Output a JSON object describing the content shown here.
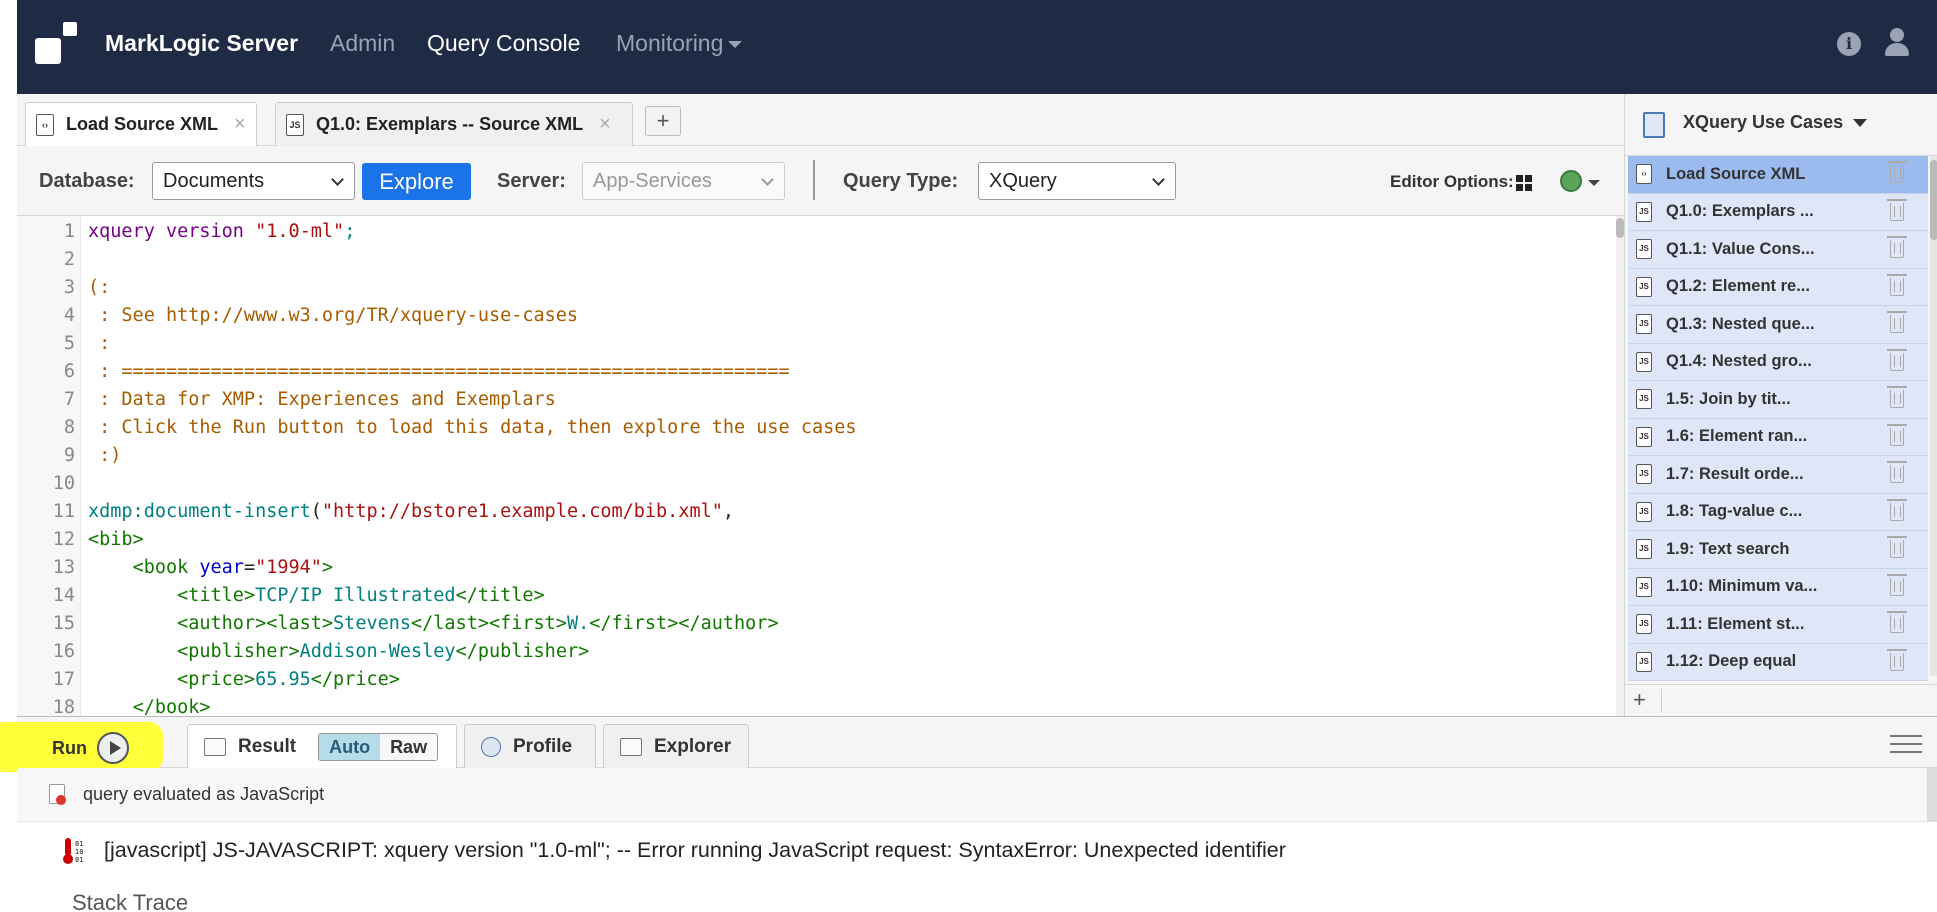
{
  "navbar": {
    "brand": "MarkLogic Server",
    "links": [
      "Admin",
      "Query Console",
      "Monitoring"
    ],
    "active_link": "Query Console",
    "info_glyph": "i",
    "icons": [
      "info-icon",
      "user-icon"
    ]
  },
  "tabs": [
    {
      "label": "Load Source XML",
      "type": "XQ",
      "active": true
    },
    {
      "label": "Q1.0: Exemplars -- Source XML",
      "type": "JS",
      "active": false
    }
  ],
  "tab_close": "×",
  "add_tab": "+",
  "options": {
    "database_label": "Database:",
    "database_value": "Documents",
    "explore_label": "Explore",
    "server_label": "Server:",
    "server_value": "App-Services",
    "query_type_label": "Query Type:",
    "query_type_value": "XQuery",
    "editor_options_label": "Editor Options:"
  },
  "editor": {
    "line_numbers": [
      "1",
      "2",
      "3",
      "4",
      "5",
      "6",
      "7",
      "8",
      "9",
      "10",
      "11",
      "12",
      "13",
      "14",
      "15",
      "16",
      "17",
      "18"
    ]
  },
  "workspace": {
    "title": "XQuery Use Cases",
    "add": "+",
    "queries": [
      {
        "label": "Load Source XML",
        "type": "XQ",
        "selected": true
      },
      {
        "label": "Q1.0: Exemplars ...",
        "type": "JS",
        "selected": false
      },
      {
        "label": "Q1.1: Value Cons...",
        "type": "JS",
        "selected": false
      },
      {
        "label": "Q1.2: Element re...",
        "type": "JS",
        "selected": false
      },
      {
        "label": "Q1.3: Nested que...",
        "type": "JS",
        "selected": false
      },
      {
        "label": "Q1.4: Nested gro...",
        "type": "JS",
        "selected": false
      },
      {
        "label": "1.5: Join by tit...",
        "type": "JS",
        "selected": false
      },
      {
        "label": "1.6: Element ran...",
        "type": "JS",
        "selected": false
      },
      {
        "label": "1.7: Result orde...",
        "type": "JS",
        "selected": false
      },
      {
        "label": "1.8: Tag-value c...",
        "type": "JS",
        "selected": false
      },
      {
        "label": "1.9: Text search",
        "type": "JS",
        "selected": false
      },
      {
        "label": "1.10: Minimum va...",
        "type": "JS",
        "selected": false
      },
      {
        "label": "1.11: Element st...",
        "type": "JS",
        "selected": false
      },
      {
        "label": "1.12: Deep equal",
        "type": "JS",
        "selected": false
      }
    ]
  },
  "runbar": {
    "run_label": "Run",
    "result_tab": "Result",
    "auto_label": "Auto",
    "raw_label": "Raw",
    "profile_tab": "Profile",
    "explorer_tab": "Explorer"
  },
  "results": {
    "status": "query evaluated as JavaScript",
    "error_icon_bits": [
      "01",
      "10",
      "01"
    ],
    "error": "[javascript] JS-JAVASCRIPT: xquery version \"1.0-ml\"; -- Error running JavaScript request: SyntaxError: Unexpected identifier",
    "stack_trace_title": "Stack Trace"
  },
  "colors": {
    "navbar_bg": "#1f2a44",
    "explore_button": "#1a73e8",
    "run_highlight": "#ffff3a",
    "selected_query": "#9bbbef",
    "query_item": "#dfe6f7"
  }
}
